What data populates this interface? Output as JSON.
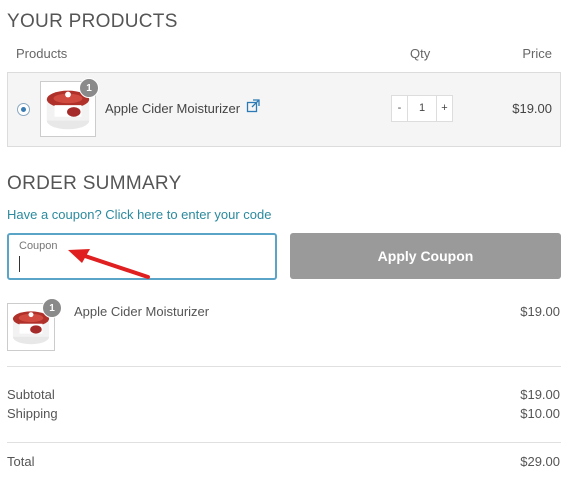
{
  "products_section": {
    "title": "YOUR PRODUCTS",
    "columns": {
      "products": "Products",
      "qty": "Qty",
      "price": "Price"
    },
    "item": {
      "name": "Apple Cider Moisturizer",
      "badge_count": "1",
      "qty": "1",
      "minus_label": "-",
      "plus_label": "+",
      "price": "$19.00"
    }
  },
  "order_summary": {
    "title": "ORDER SUMMARY",
    "coupon_link": "Have a coupon? Click here to enter your code",
    "coupon_label": "Coupon",
    "coupon_value": "",
    "apply_button": "Apply Coupon",
    "item": {
      "name": "Apple Cider Moisturizer",
      "badge_count": "1",
      "price": "$19.00"
    },
    "subtotal_label": "Subtotal",
    "subtotal_value": "$19.00",
    "shipping_label": "Shipping",
    "shipping_value": "$10.00",
    "total_label": "Total",
    "total_value": "$29.00"
  },
  "colors": {
    "accent_link": "#2b8a9e",
    "focus_border": "#5aa4c8",
    "button_bg": "#9a9a9a",
    "annotation_arrow": "#e02020"
  },
  "icons": [
    "external-link-icon",
    "product-thumbnail",
    "annotation-arrow"
  ]
}
